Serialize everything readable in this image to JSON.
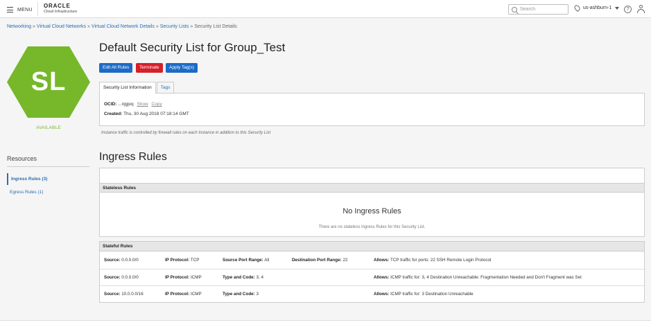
{
  "topbar": {
    "menu_label": "MENU",
    "logo_main": "ORACLE",
    "logo_sub": "Cloud Infrastructure",
    "search_placeholder": "Search",
    "region": "us-ashburn-1",
    "help_glyph": "?"
  },
  "breadcrumb": {
    "items": [
      "Networking",
      "Virtual Cloud Networks",
      "Virtual Cloud Network Details",
      "Security Lists"
    ],
    "current": "Security List Details",
    "separator": "»"
  },
  "resource": {
    "initials": "SL",
    "status": "AVAILABLE",
    "hex_color": "#76b82a"
  },
  "resources_nav": {
    "title": "Resources",
    "items": [
      {
        "label": "Ingress Rules (3)"
      },
      {
        "label": "Egress Rules (1)"
      }
    ]
  },
  "page": {
    "title": "Default Security List for Group_Test",
    "buttons": {
      "edit": "Edit All Rules",
      "terminate": "Terminate",
      "apply_tags": "Apply Tag(s)"
    },
    "tabs": [
      "Security List Information",
      "Tags"
    ],
    "info": {
      "ocid_label": "OCID:",
      "ocid_value": "...njgjvq",
      "show": "Show",
      "copy": "Copy",
      "created_label": "Created:",
      "created_value": "Thu, 30 Aug 2018 07:18:14 GMT"
    },
    "note": "Instance traffic is controlled by firewall rules on each Instance in addition to this Security List"
  },
  "ingress": {
    "title": "Ingress Rules",
    "stateless_heading": "Stateless Rules",
    "empty_title": "No Ingress Rules",
    "empty_text": "There are no stateless Ingress Rules for this Security List.",
    "stateful_heading": "Stateful Rules",
    "rules": [
      {
        "source_label": "Source:",
        "source": "0.0.0.0/0",
        "proto_label": "IP Protocol:",
        "proto": "TCP",
        "c3_label": "Source Port Range:",
        "c3": "All",
        "c4_label": "Destination Port Range:",
        "c4": "22",
        "allows_label": "Allows:",
        "allows": "TCP traffic for ports: 22 SSH Remote Login Protocol"
      },
      {
        "source_label": "Source:",
        "source": "0.0.0.0/0",
        "proto_label": "IP Protocol:",
        "proto": "ICMP",
        "c3_label": "Type and Code:",
        "c3": "3, 4",
        "c4_label": "",
        "c4": "",
        "allows_label": "Allows:",
        "allows": "ICMP traffic for: 3, 4 Destination Unreachable: Fragmentation Needed and Don't Fragment was Set"
      },
      {
        "source_label": "Source:",
        "source": "10.0.0.0/16",
        "proto_label": "IP Protocol:",
        "proto": "ICMP",
        "c3_label": "Type and Code:",
        "c3": "3",
        "c4_label": "",
        "c4": "",
        "allows_label": "Allows:",
        "allows": "ICMP traffic for: 3 Destination Unreachable"
      }
    ]
  }
}
